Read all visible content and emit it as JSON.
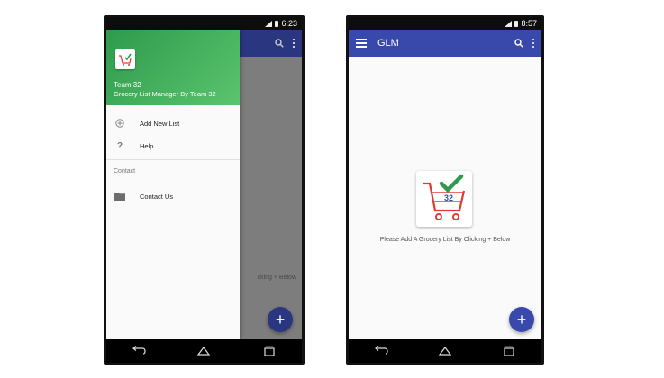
{
  "left_phone": {
    "status_time": "6:23",
    "drawer": {
      "team_name": "Team 32",
      "subtitle": "Grocery List Manager By Team 32",
      "items": [
        {
          "label": "Add New List",
          "icon": "add-circle-icon"
        },
        {
          "label": "Help",
          "icon": "help-icon"
        }
      ],
      "section_label": "Contact",
      "contact_item": {
        "label": "Contact Us",
        "icon": "folder-icon"
      }
    },
    "background_text": "cking + Below",
    "fab_label": "+"
  },
  "right_phone": {
    "status_time": "8:57",
    "app_title": "GLM",
    "logo_number": "32",
    "empty_message": "Please Add A Grocery List By Clicking + Below",
    "fab_label": "+"
  },
  "colors": {
    "appbar": "#3949ab",
    "drawer_header": "#43b15e",
    "cart_red": "#e53935",
    "check_green": "#2e9a4c"
  }
}
